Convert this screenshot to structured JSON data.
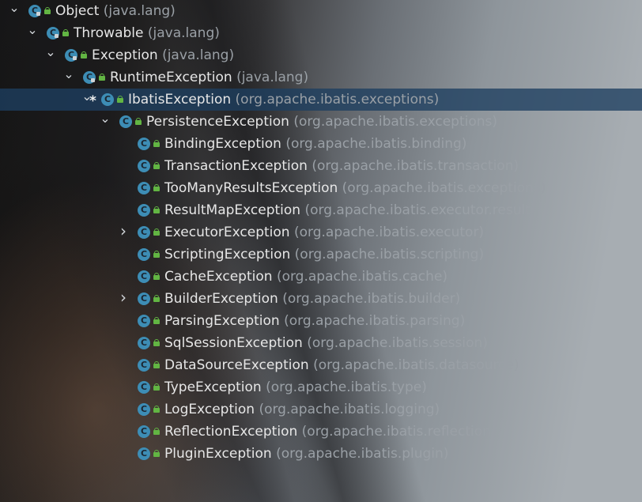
{
  "tree": {
    "rows": [
      {
        "name": "Object",
        "package": "(java.lang)",
        "depth": 0,
        "expanded": true,
        "chevron": "down",
        "marker": "",
        "selected": false
      },
      {
        "name": "Throwable",
        "package": "(java.lang)",
        "depth": 1,
        "expanded": true,
        "chevron": "down",
        "marker": "",
        "selected": false
      },
      {
        "name": "Exception",
        "package": "(java.lang)",
        "depth": 2,
        "expanded": true,
        "chevron": "down",
        "marker": "",
        "selected": false
      },
      {
        "name": "RuntimeException",
        "package": "(java.lang)",
        "depth": 3,
        "expanded": true,
        "chevron": "down",
        "marker": "",
        "selected": false
      },
      {
        "name": "IbatisException",
        "package": "(org.apache.ibatis.exceptions)",
        "depth": 4,
        "expanded": true,
        "chevron": "down",
        "marker": "*",
        "selected": true
      },
      {
        "name": "PersistenceException",
        "package": "(org.apache.ibatis.exceptions)",
        "depth": 5,
        "expanded": true,
        "chevron": "down",
        "marker": "",
        "selected": false
      },
      {
        "name": "BindingException",
        "package": "(org.apache.ibatis.binding)",
        "depth": 6,
        "chevron": "none",
        "marker": "",
        "selected": false
      },
      {
        "name": "TransactionException",
        "package": "(org.apache.ibatis.transaction)",
        "depth": 6,
        "chevron": "none",
        "marker": "",
        "selected": false
      },
      {
        "name": "TooManyResultsException",
        "package": "(org.apache.ibatis.exceptions)",
        "depth": 6,
        "chevron": "none",
        "marker": "",
        "selected": false
      },
      {
        "name": "ResultMapException",
        "package": "(org.apache.ibatis.executor.result)",
        "depth": 6,
        "chevron": "none",
        "marker": "",
        "selected": false
      },
      {
        "name": "ExecutorException",
        "package": "(org.apache.ibatis.executor)",
        "depth": 6,
        "chevron": "right",
        "marker": "",
        "selected": false
      },
      {
        "name": "ScriptingException",
        "package": "(org.apache.ibatis.scripting)",
        "depth": 6,
        "chevron": "none",
        "marker": "",
        "selected": false
      },
      {
        "name": "CacheException",
        "package": "(org.apache.ibatis.cache)",
        "depth": 6,
        "chevron": "none",
        "marker": "",
        "selected": false
      },
      {
        "name": "BuilderException",
        "package": "(org.apache.ibatis.builder)",
        "depth": 6,
        "chevron": "right",
        "marker": "",
        "selected": false
      },
      {
        "name": "ParsingException",
        "package": "(org.apache.ibatis.parsing)",
        "depth": 6,
        "chevron": "none",
        "marker": "",
        "selected": false
      },
      {
        "name": "SqlSessionException",
        "package": "(org.apache.ibatis.session)",
        "depth": 6,
        "chevron": "none",
        "marker": "",
        "selected": false
      },
      {
        "name": "DataSourceException",
        "package": "(org.apache.ibatis.datasource)",
        "depth": 6,
        "chevron": "none",
        "marker": "",
        "selected": false
      },
      {
        "name": "TypeException",
        "package": "(org.apache.ibatis.type)",
        "depth": 6,
        "chevron": "none",
        "marker": "",
        "selected": false
      },
      {
        "name": "LogException",
        "package": "(org.apache.ibatis.logging)",
        "depth": 6,
        "chevron": "none",
        "marker": "",
        "selected": false
      },
      {
        "name": "ReflectionException",
        "package": "(org.apache.ibatis.reflection)",
        "depth": 6,
        "chevron": "none",
        "marker": "",
        "selected": false
      },
      {
        "name": "PluginException",
        "package": "(org.apache.ibatis.plugin)",
        "depth": 6,
        "chevron": "none",
        "marker": "",
        "selected": false
      }
    ],
    "class_icon_letter": "C",
    "icons": {
      "expanded": "chevron-down-icon",
      "collapsed": "chevron-right-icon",
      "class": "class-icon",
      "visibility": "public-lock-icon"
    },
    "colors": {
      "selection": "#1e3f60",
      "class_icon": "#3d8db5",
      "public_lock": "#62b543",
      "name_text": "#e6e6e6",
      "package_text": "#9aa0a6"
    }
  }
}
